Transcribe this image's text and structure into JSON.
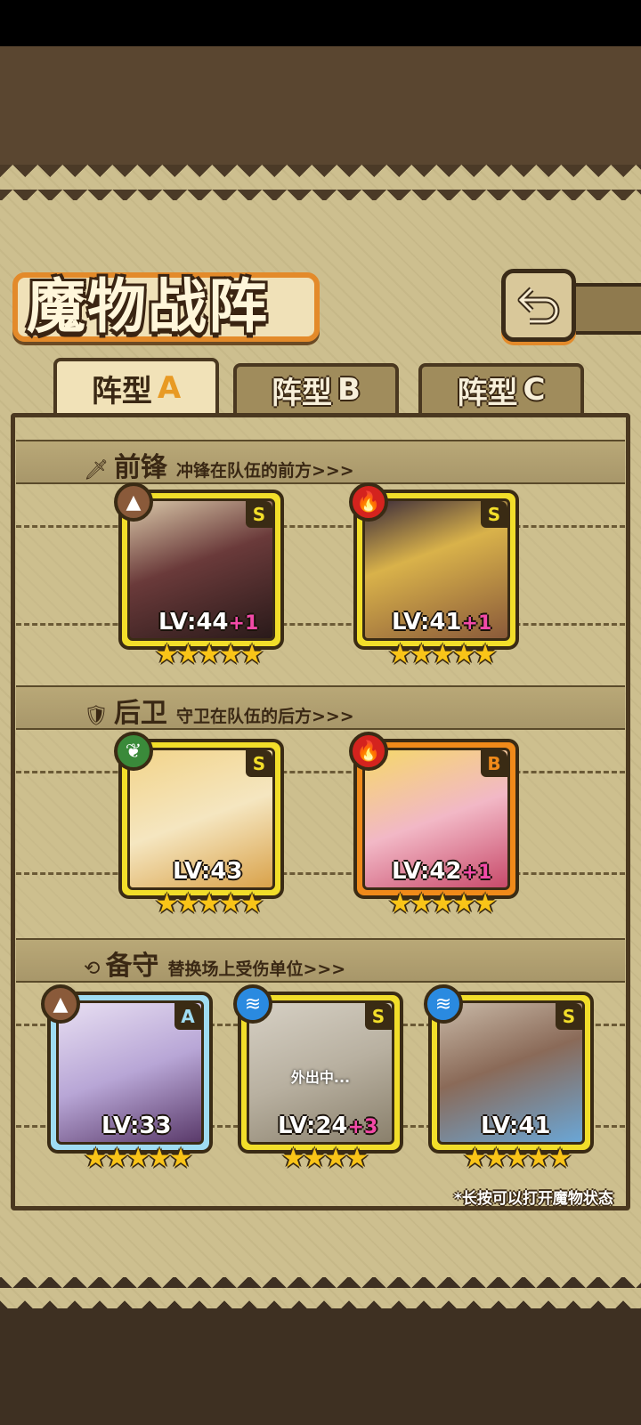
{
  "title": "魔物战阵",
  "back_icon": "return-arrow-icon",
  "tabs": [
    {
      "label": "阵型",
      "letter": "A",
      "active": true
    },
    {
      "label": "阵型",
      "letter": "B",
      "active": false
    },
    {
      "label": "阵型",
      "letter": "C",
      "active": false
    }
  ],
  "sections": {
    "front": {
      "icon": "sword-icon",
      "name": "前锋",
      "desc": "冲锋在队伍的前方>>>"
    },
    "rear": {
      "icon": "shield-icon",
      "name": "后卫",
      "desc": "守卫在队伍的后方>>>"
    },
    "reserve": {
      "icon": "swap-icon",
      "name": "备守",
      "desc": "替换场上受伤单位>>>"
    }
  },
  "front_cards": [
    {
      "element": "earth",
      "rarity": "S",
      "level": "LV:44",
      "plus": "+1",
      "stars": "★★★★★",
      "frame": "gold"
    },
    {
      "element": "fire",
      "rarity": "S",
      "level": "LV:41",
      "plus": "+1",
      "stars": "★★★★★",
      "frame": "gold"
    }
  ],
  "rear_cards": [
    {
      "element": "wind",
      "rarity": "S",
      "level": "LV:43",
      "plus": "",
      "stars": "★★★★★",
      "frame": "gold"
    },
    {
      "element": "fire",
      "rarity": "B",
      "level": "LV:42",
      "plus": "+1",
      "stars": "★★★★★",
      "frame": "orange"
    }
  ],
  "reserve_cards": [
    {
      "element": "earth",
      "rarity": "A",
      "level": "LV:33",
      "plus": "",
      "stars": "★★★★★",
      "frame": "blue",
      "status": ""
    },
    {
      "element": "water",
      "rarity": "S",
      "level": "LV:24",
      "plus": "+3",
      "stars": "★★★★",
      "frame": "gold",
      "status": "外出中..."
    },
    {
      "element": "water",
      "rarity": "S",
      "level": "LV:41",
      "plus": "",
      "stars": "★★★★★",
      "frame": "gold",
      "status": ""
    }
  ],
  "hint": "*长按可以打开魔物状态"
}
